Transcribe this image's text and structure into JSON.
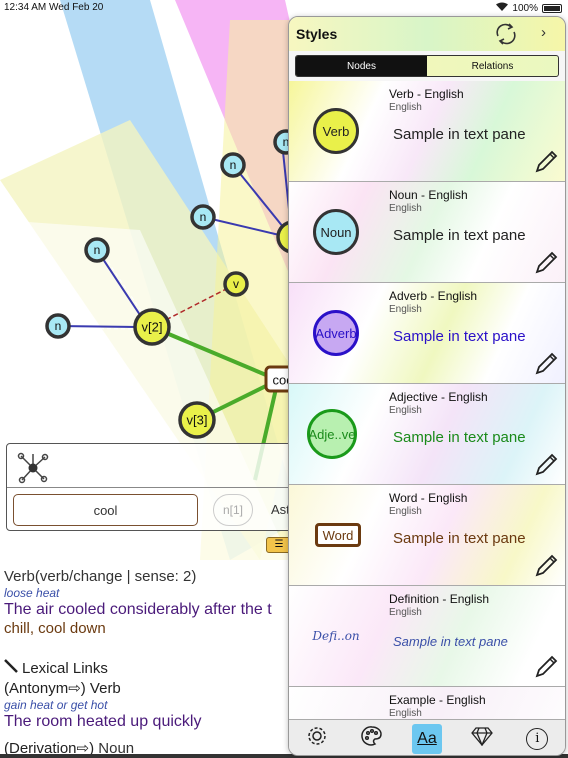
{
  "status_bar": {
    "time": "12:34 AM  Wed Feb 20",
    "battery": "100%"
  },
  "graph": {
    "nodes": [
      {
        "id": "v2",
        "label": "v[2]"
      },
      {
        "id": "v3",
        "label": "v[3]"
      },
      {
        "id": "v",
        "label": "v"
      },
      {
        "id": "n1",
        "label": "n"
      },
      {
        "id": "n2",
        "label": "n"
      },
      {
        "id": "n3",
        "label": "n"
      },
      {
        "id": "n4",
        "label": "n"
      },
      {
        "id": "n5",
        "label": "n"
      },
      {
        "id": "root",
        "label": "coo"
      },
      {
        "id": "n1ghost",
        "label": "n[1]"
      }
    ]
  },
  "search_panel": {
    "word": "cool",
    "ghost_chip": "n[1]",
    "right_chip": "Ast"
  },
  "text_pane": {
    "sense": "Verb(verb/change | sense: 2)",
    "gloss": "loose heat",
    "example": "The air cooled considerably after the t",
    "synonyms": "chill, cool down",
    "lexical_links": "Lexical Links",
    "antonym_line": "(Antonym⇨) Verb",
    "antonym_gloss": "gain heat or get hot",
    "antonym_example": "The room heated up quickly",
    "derivation_prefix": "(Derivation⇨) ",
    "derivation_pos": "Noun"
  },
  "styles_panel": {
    "title": "Styles",
    "tabs": [
      "Nodes",
      "Relations"
    ],
    "active_tab": "Nodes",
    "rows": [
      {
        "badge": "Verb",
        "title": "Verb - English",
        "lang": "English",
        "sample": "Sample in text pane",
        "fill": "#e9f04a",
        "border": "#333333",
        "color": "#222222",
        "shape": "circle"
      },
      {
        "badge": "Noun",
        "title": "Noun - English",
        "lang": "English",
        "sample": "Sample in text pane",
        "fill": "#a8e8f4",
        "border": "#333333",
        "color": "#222222",
        "shape": "circle"
      },
      {
        "badge": "Adverb",
        "title": "Adverb - English",
        "lang": "English",
        "sample": "Sample in text pane",
        "fill": "#c7a8f2",
        "border": "#2a10c8",
        "color": "#2a10c8",
        "shape": "circle"
      },
      {
        "badge": "Adje..ve",
        "title": "Adjective - English",
        "lang": "English",
        "sample": "Sample in text pane",
        "fill": "#b8f0b0",
        "border": "#1a9a1a",
        "color": "#1a8a1a",
        "shape": "circle"
      },
      {
        "badge": "Word",
        "title": "Word - English",
        "lang": "English",
        "sample": "Sample in text pane",
        "fill": "#ffffff",
        "border": "#6b3a10",
        "color": "#6b3a10",
        "shape": "rect"
      },
      {
        "badge": "Defi..on",
        "title": "Definition - English",
        "lang": "English",
        "sample": "Sample in text pane",
        "fill": "transparent",
        "border": "transparent",
        "color": "#3a4fa8",
        "shape": "none"
      },
      {
        "badge": "",
        "title": "Example - English",
        "lang": "English",
        "sample": "",
        "fill": "transparent",
        "border": "transparent",
        "color": "#333333",
        "shape": "none"
      }
    ],
    "tab_bar": [
      "settings-icon",
      "palette-icon",
      "text-style-icon",
      "gem-icon",
      "info-icon"
    ],
    "active_tab_bar": "text-style-icon",
    "text_style_label": "Aa",
    "info_label": "i"
  }
}
